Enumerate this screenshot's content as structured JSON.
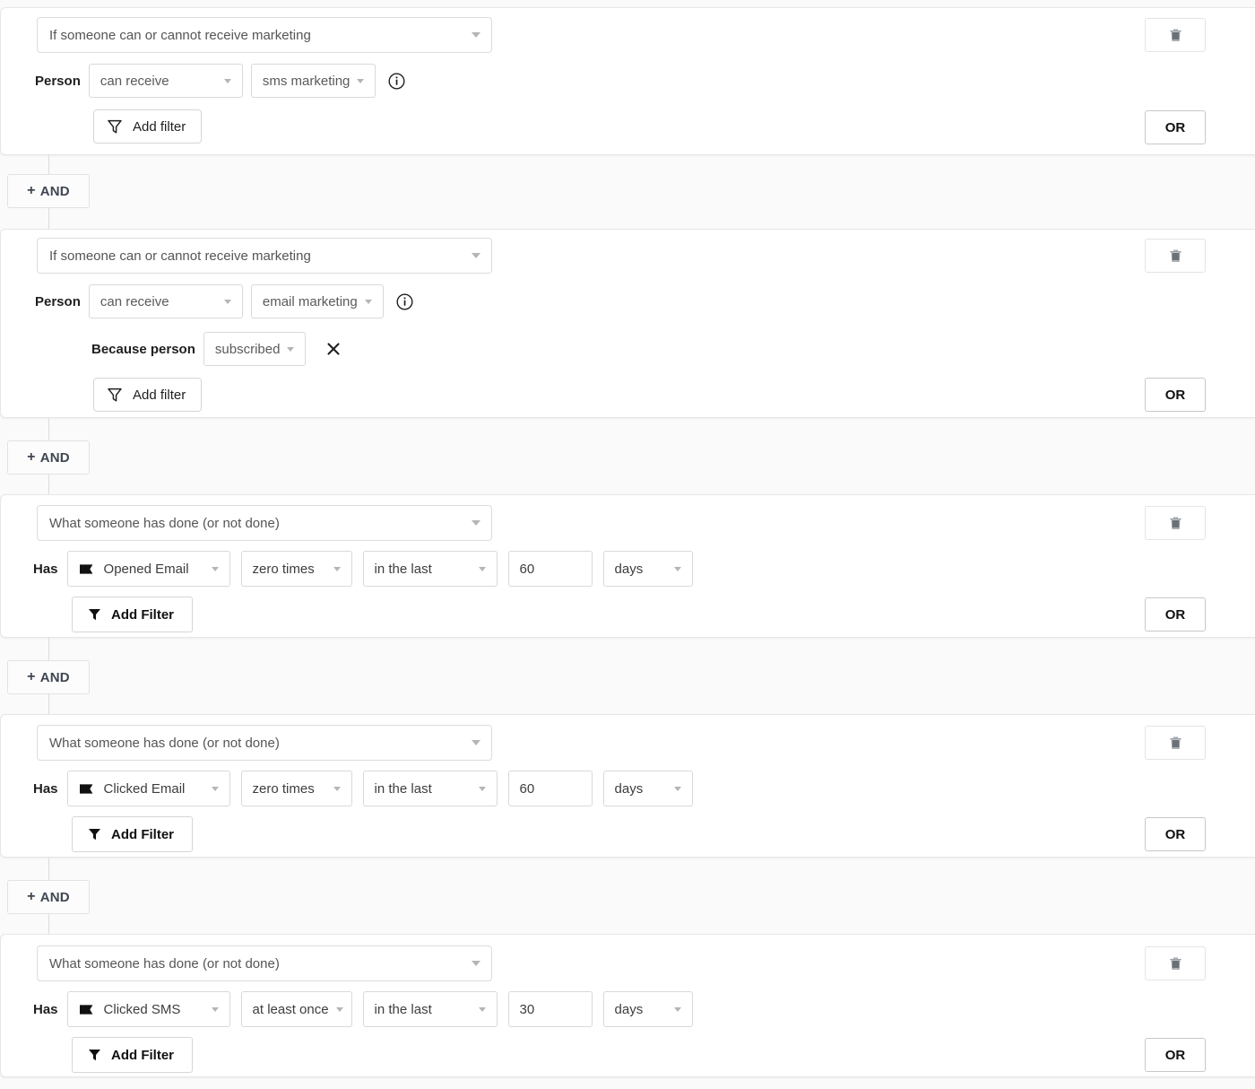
{
  "blocks": [
    {
      "kind": "marketing",
      "type_label": "If someone can or cannot receive marketing",
      "row_label": "Person",
      "permission": "can receive",
      "channel": "sms marketing",
      "info_icon": "info-circle-icon",
      "has_reason": false,
      "add_filter_label": "Add filter",
      "add_filter_icon": "funnel-outline-icon",
      "delete_icon": "trash-icon",
      "or_label": "OR"
    },
    {
      "kind": "marketing",
      "type_label": "If someone can or cannot receive marketing",
      "row_label": "Person",
      "permission": "can receive",
      "channel": "email marketing",
      "info_icon": "info-circle-icon",
      "has_reason": true,
      "reason_label": "Because person",
      "reason_value": "subscribed",
      "reason_remove_icon": "close-x-icon",
      "add_filter_label": "Add filter",
      "add_filter_icon": "funnel-outline-icon",
      "delete_icon": "trash-icon",
      "or_label": "OR"
    },
    {
      "kind": "activity",
      "type_label": "What someone has done (or not done)",
      "row_label": "Has",
      "metric_icon": "flag-solid-icon",
      "metric": "Opened Email",
      "count": "zero times",
      "when": "in the last",
      "amount": "60",
      "unit": "days",
      "add_filter_label": "Add Filter",
      "add_filter_icon": "funnel-solid-icon",
      "delete_icon": "trash-icon",
      "or_label": "OR"
    },
    {
      "kind": "activity",
      "type_label": "What someone has done (or not done)",
      "row_label": "Has",
      "metric_icon": "flag-solid-icon",
      "metric": "Clicked Email",
      "count": "zero times",
      "when": "in the last",
      "amount": "60",
      "unit": "days",
      "add_filter_label": "Add Filter",
      "add_filter_icon": "funnel-solid-icon",
      "delete_icon": "trash-icon",
      "or_label": "OR"
    },
    {
      "kind": "activity",
      "type_label": "What someone has done (or not done)",
      "row_label": "Has",
      "metric_icon": "flag-solid-icon",
      "metric": "Clicked SMS",
      "count": "at least once",
      "when": "in the last",
      "amount": "30",
      "unit": "days",
      "add_filter_label": "Add Filter",
      "add_filter_icon": "funnel-solid-icon",
      "delete_icon": "trash-icon",
      "or_label": "OR"
    }
  ],
  "connectors": [
    {
      "label": "AND",
      "plus": "+"
    },
    {
      "label": "AND",
      "plus": "+"
    },
    {
      "label": "AND",
      "plus": "+"
    },
    {
      "label": "AND",
      "plus": "+"
    }
  ],
  "colors": {
    "card_bg": "#ffffff",
    "page_bg": "#fafafa",
    "border": "#d9d9d9",
    "text": "#1f1f1f",
    "muted_text": "#5a5a5a",
    "placeholder_text": "#555555",
    "caret": "#b5b5b5",
    "and_text": "#3f4651"
  }
}
